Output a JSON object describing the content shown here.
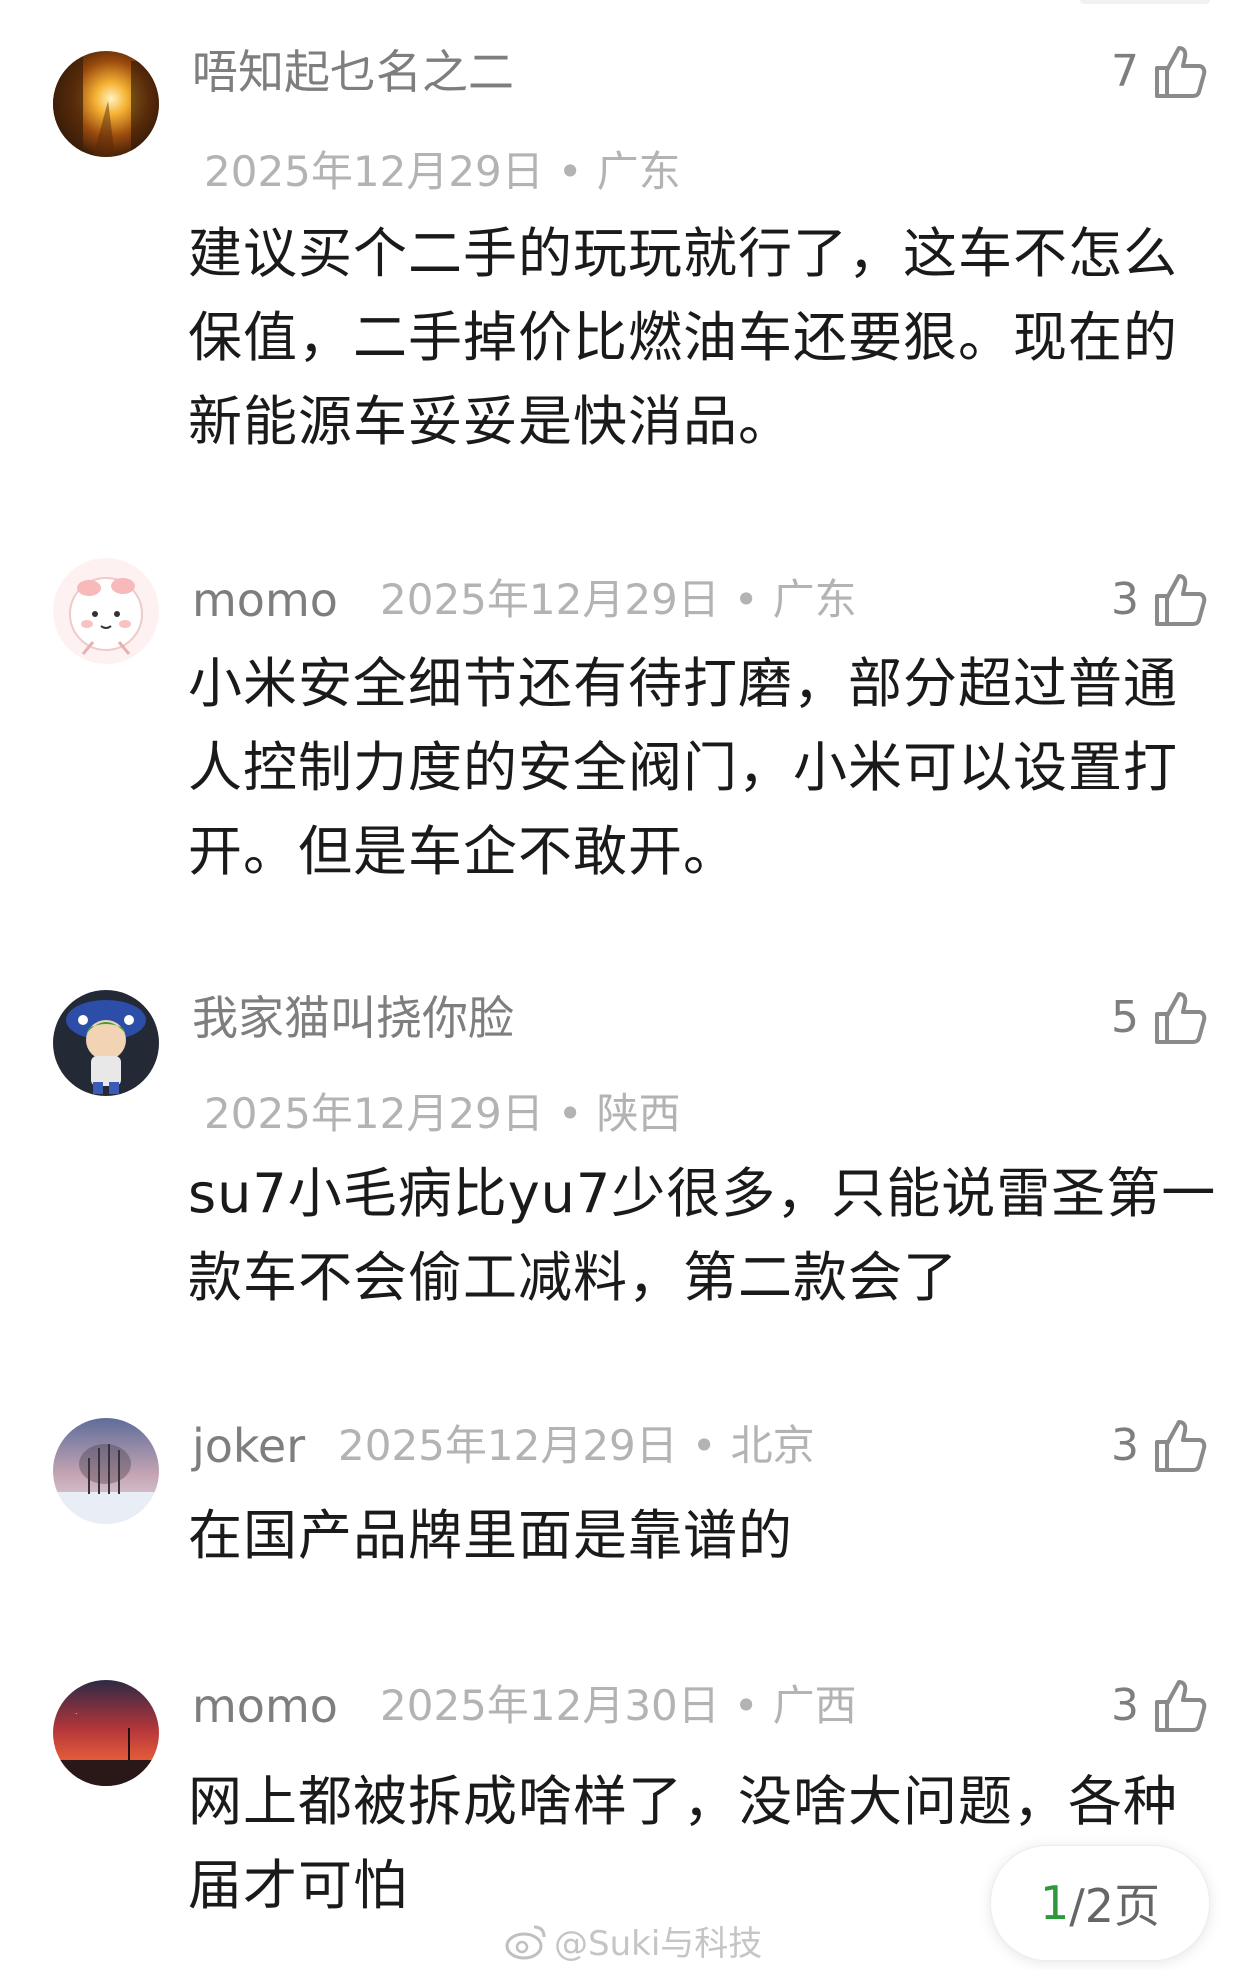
{
  "comments": [
    {
      "username": "唔知起乜名之二",
      "date": "2025年12月29日",
      "dot": "•",
      "location": "广东",
      "likes": "7",
      "text": "建议买个二手的玩玩就行了，这车不怎么保值，二手掉价比燃油车还要狠。现在的新能源车妥妥是快消品。",
      "avatar": "sunset-street-avatar"
    },
    {
      "username": "momo",
      "date": "2025年12月29日",
      "dot": "•",
      "location": "广东",
      "likes": "3",
      "text": "小米安全细节还有待打磨，部分超过普通人控制力度的安全阀门，小米可以设置打开。但是车企不敢开。",
      "avatar": "pink-cartoon-avatar"
    },
    {
      "username": "我家猫叫挠你脸",
      "date": "2025年12月29日",
      "dot": "•",
      "location": "陕西",
      "likes": "5",
      "text": "su7小毛病比yu7少很多，只能说雷圣第一款车不会偷工减料，第二款会了",
      "avatar": "toy-figure-avatar"
    },
    {
      "username": "joker",
      "date": "2025年12月29日",
      "dot": "•",
      "location": "北京",
      "likes": "3",
      "text": "在国产品牌里面是靠谱的",
      "avatar": "winter-trees-avatar"
    },
    {
      "username": "momo",
      "date": "2025年12月30日",
      "dot": "•",
      "location": "广西",
      "likes": "3",
      "text": "网上都被拆成啥样了，没啥大问题，各种届才可怕",
      "avatar": "red-sky-avatar"
    }
  ],
  "pager": {
    "current": "1",
    "total": "/2页"
  },
  "watermark": {
    "text": "@Suki与科技",
    "icon": "weibo-icon"
  },
  "colors": {
    "text": "#1a1a1a",
    "username": "#7e7e7e",
    "meta": "#b3b3b3",
    "pager_current": "#2c9a3b"
  }
}
